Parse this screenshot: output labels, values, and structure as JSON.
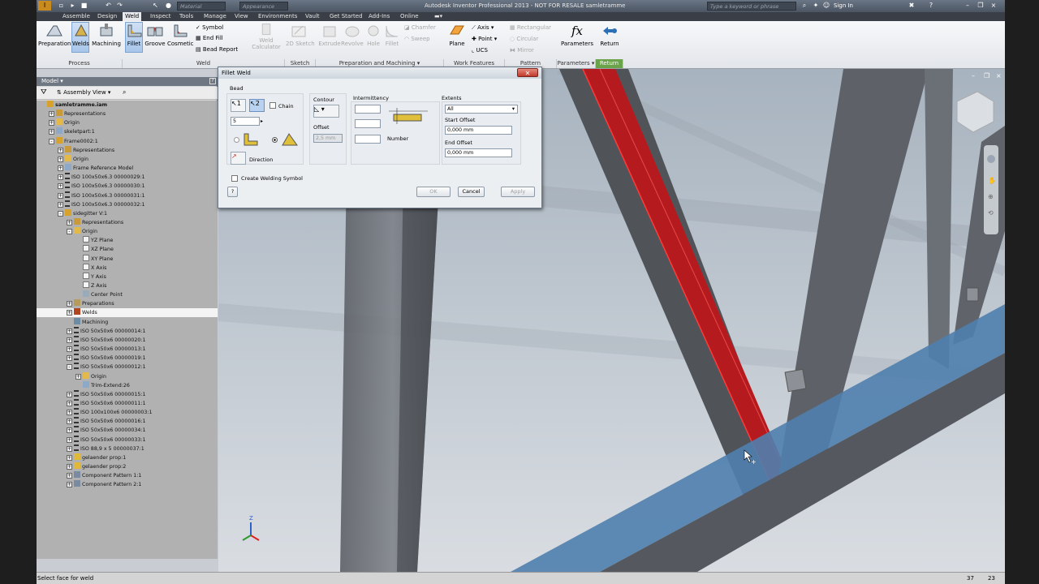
{
  "titlebar": {
    "title": "Autodesk Inventor Professional 2013 - NOT FOR RESALE   samletramme",
    "material": "Material",
    "appearance": "Appearance",
    "search_placeholder": "Type a keyword or phrase",
    "sign_in": "Sign In"
  },
  "tabs": [
    "Assemble",
    "Design",
    "Weld",
    "Inspect",
    "Tools",
    "Manage",
    "View",
    "Environments",
    "Vault",
    "Get Started",
    "Add-Ins",
    "Online"
  ],
  "ribbon": {
    "preparation": "Preparation",
    "welds": "Welds",
    "machining": "Machining",
    "fillet": "Fillet",
    "groove": "Groove",
    "cosmetic": "Cosmetic",
    "symbol": "Symbol",
    "end_fill": "End Fill",
    "bead_report": "Bead Report",
    "weld_calculator": "Weld Calculator",
    "sketch_2d": "2D Sketch",
    "extrude": "Extrude",
    "revolve": "Revolve",
    "hole": "Hole",
    "fillet2": "Fillet",
    "chamfer": "Chamfer",
    "sweep": "Sweep",
    "plane": "Plane",
    "axis": "Axis",
    "point": "Point",
    "ucs": "UCS",
    "rectangular": "Rectangular",
    "circular": "Circular",
    "mirror": "Mirror",
    "parameters": "Parameters",
    "return": "Return",
    "groups": {
      "process": "Process",
      "weld": "Weld",
      "sketch": "Sketch",
      "prep_machining": "Preparation and Machining ▾",
      "work_features": "Work Features",
      "pattern": "Pattern",
      "parameters": "Parameters ▾",
      "return": "Return"
    }
  },
  "browser": {
    "header": "Model ▾",
    "view": "Assembly View",
    "nodes": [
      {
        "label": "samletramme.iam",
        "indent": 0,
        "icon": "asm",
        "bold": true
      },
      {
        "label": "Representations",
        "indent": 1,
        "icon": "rep",
        "pm": "+"
      },
      {
        "label": "Origin",
        "indent": 1,
        "icon": "folder",
        "pm": "+"
      },
      {
        "label": "skeletpart:1",
        "indent": 1,
        "icon": "part",
        "pm": "+"
      },
      {
        "label": "Frame0002:1",
        "indent": 1,
        "icon": "asm",
        "pm": "-"
      },
      {
        "label": "Representations",
        "indent": 2,
        "icon": "rep",
        "pm": "+"
      },
      {
        "label": "Origin",
        "indent": 2,
        "icon": "folder",
        "pm": "+"
      },
      {
        "label": "Frame Reference Model",
        "indent": 2,
        "icon": "part",
        "pm": "+"
      },
      {
        "label": "ISO 100x50x6.3 00000029:1",
        "indent": 2,
        "icon": "beam",
        "pm": "+"
      },
      {
        "label": "ISO 100x50x6.3 00000030:1",
        "indent": 2,
        "icon": "beam",
        "pm": "+"
      },
      {
        "label": "ISO 100x50x6.3 00000031:1",
        "indent": 2,
        "icon": "beam",
        "pm": "+"
      },
      {
        "label": "ISO 100x50x6.3 00000032:1",
        "indent": 2,
        "icon": "beam",
        "pm": "+"
      },
      {
        "label": "sidegitter V:1",
        "indent": 2,
        "icon": "asm",
        "pm": "-"
      },
      {
        "label": "Representations",
        "indent": 3,
        "icon": "rep",
        "pm": "+"
      },
      {
        "label": "Origin",
        "indent": 3,
        "icon": "folder",
        "pm": "-"
      },
      {
        "label": "YZ Plane",
        "indent": 4,
        "icon": "plane"
      },
      {
        "label": "XZ Plane",
        "indent": 4,
        "icon": "plane"
      },
      {
        "label": "XY Plane",
        "indent": 4,
        "icon": "plane"
      },
      {
        "label": "X Axis",
        "indent": 4,
        "icon": "plane"
      },
      {
        "label": "Y Axis",
        "indent": 4,
        "icon": "plane"
      },
      {
        "label": "Z Axis",
        "indent": 4,
        "icon": "plane"
      },
      {
        "label": "Center Point",
        "indent": 4,
        "icon": "point"
      },
      {
        "label": "Preparations",
        "indent": 3,
        "icon": "prep",
        "pm": "+"
      },
      {
        "label": "Welds",
        "indent": 3,
        "icon": "weld",
        "pm": "+",
        "hl": true
      },
      {
        "label": "Machining",
        "indent": 3,
        "icon": "mach"
      },
      {
        "label": "ISO 50x50x6 00000014:1",
        "indent": 3,
        "icon": "beam",
        "pm": "+"
      },
      {
        "label": "ISO 50x50x6 00000020:1",
        "indent": 3,
        "icon": "beam",
        "pm": "+"
      },
      {
        "label": "ISO 50x50x6 00000013:1",
        "indent": 3,
        "icon": "beam",
        "pm": "+"
      },
      {
        "label": "ISO 50x50x6 00000019:1",
        "indent": 3,
        "icon": "beam",
        "pm": "+"
      },
      {
        "label": "ISO 50x50x6 00000012:1",
        "indent": 3,
        "icon": "beam",
        "pm": "-"
      },
      {
        "label": "Origin",
        "indent": 4,
        "icon": "folder",
        "pm": "+"
      },
      {
        "label": "Trim-Extend:26",
        "indent": 4,
        "icon": "part"
      },
      {
        "label": "ISO 50x50x6 00000015:1",
        "indent": 3,
        "icon": "beam",
        "pm": "+"
      },
      {
        "label": "ISO 50x50x6 00000011:1",
        "indent": 3,
        "icon": "beam",
        "pm": "+"
      },
      {
        "label": "ISO 100x100x6 00000003:1",
        "indent": 3,
        "icon": "beam",
        "pm": "+"
      },
      {
        "label": "ISO 50x50x6 00000016:1",
        "indent": 3,
        "icon": "beam",
        "pm": "+"
      },
      {
        "label": "ISO 50x50x6 00000034:1",
        "indent": 3,
        "icon": "beam",
        "pm": "+"
      },
      {
        "label": "ISO 50x50x6 00000033:1",
        "indent": 3,
        "icon": "beam",
        "pm": "+"
      },
      {
        "label": "ISO 88,9 x 5 00000037:1",
        "indent": 3,
        "icon": "beam",
        "pm": "+"
      },
      {
        "label": "gelaender prop:1",
        "indent": 3,
        "icon": "asmy",
        "pm": "+"
      },
      {
        "label": "gelaender prop:2",
        "indent": 3,
        "icon": "asmy",
        "pm": "+"
      },
      {
        "label": "Component Pattern 1:1",
        "indent": 3,
        "icon": "pat",
        "pm": "+"
      },
      {
        "label": "Component Pattern 2:1",
        "indent": 3,
        "icon": "pat",
        "pm": "+"
      }
    ]
  },
  "dialog": {
    "title": "Fillet Weld",
    "bead": "Bead",
    "chain": "Chain",
    "bead_size": "5",
    "direction": "Direction",
    "contour": "Contour",
    "offset": "Offset",
    "offset_value": "2,5 mm",
    "intermittency": "Intermittency",
    "number": "Number",
    "extents": "Extents",
    "extents_value": "All",
    "start_offset": "Start Offset",
    "start_value": "0,000 mm",
    "end_offset": "End Offset",
    "end_value": "0,000 mm",
    "create_symbol": "Create Welding Symbol",
    "ok": "OK",
    "cancel": "Cancel",
    "apply": "Apply",
    "help": "?"
  },
  "status": {
    "text": "Select face for weld",
    "n1": "37",
    "n2": "23"
  },
  "colors": {
    "weld_red": "#c0181c",
    "beam_blue": "#4f7fae",
    "frame_gray": "#5a5f66",
    "ribbon_active": "#b7cfee"
  }
}
